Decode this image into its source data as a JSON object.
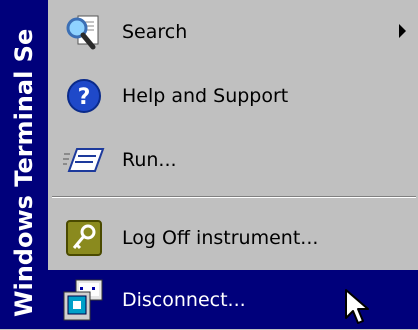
{
  "banner": {
    "text": "Windows Terminal Se"
  },
  "menu": {
    "items": [
      {
        "label": "Search",
        "icon": "search-icon",
        "has_submenu": true
      },
      {
        "label": "Help and Support",
        "icon": "help-icon"
      },
      {
        "label": "Run...",
        "icon": "run-icon"
      },
      {
        "label": "Log Off instrument...",
        "icon": "log-off-icon"
      },
      {
        "label": "Disconnect...",
        "icon": "disconnect-icon",
        "selected": true
      }
    ]
  },
  "colors": {
    "menu_bg": "#c0c0c0",
    "highlight": "#00007b",
    "banner": "#00007b"
  }
}
